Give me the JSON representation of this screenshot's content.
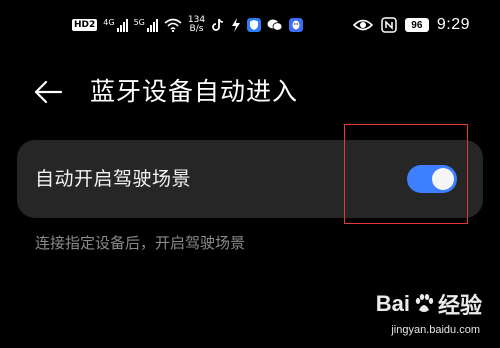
{
  "status_bar": {
    "hd_label": "HD",
    "hd_sub": "2",
    "signal_1_label": "4G",
    "signal_2_label": "5G",
    "net_speed_value": "134",
    "net_speed_unit": "B/s",
    "battery_level": "96",
    "time": "9:29",
    "icons": [
      "tiktok-icon",
      "bolt-icon",
      "shield-icon",
      "wechat-icon",
      "qq-icon",
      "eye-icon",
      "nfc-icon"
    ]
  },
  "header": {
    "title": "蓝牙设备自动进入"
  },
  "setting": {
    "label": "自动开启驾驶场景",
    "enabled": true,
    "toggle_color": "#3e7fff"
  },
  "description": "连接指定设备后，开启驾驶场景",
  "watermark": {
    "logo_left": "Bai",
    "logo_right": "经验",
    "url": "jingyan.baidu.com"
  },
  "colors": {
    "background": "#000000",
    "card": "#262626",
    "highlight": "#e53935"
  }
}
